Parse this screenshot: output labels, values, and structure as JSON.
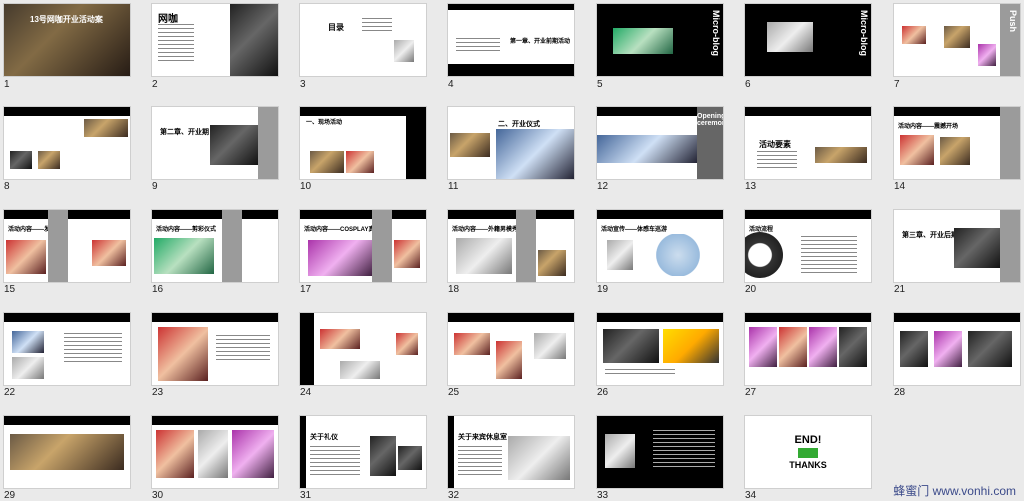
{
  "slides": [
    {
      "num": "1",
      "text": "13号网咖开业活动案"
    },
    {
      "num": "2",
      "text": "网咖"
    },
    {
      "num": "3",
      "text": "目录"
    },
    {
      "num": "4",
      "text": "第一章、开业前期活动"
    },
    {
      "num": "5",
      "text": "Micro-blog"
    },
    {
      "num": "6",
      "text": "Micro-blog"
    },
    {
      "num": "7",
      "text": "Push"
    },
    {
      "num": "8",
      "text": ""
    },
    {
      "num": "9",
      "text": "第二章、开业期"
    },
    {
      "num": "10",
      "text": "一、现场活动"
    },
    {
      "num": "11",
      "text": "二、开业仪式"
    },
    {
      "num": "12",
      "text": "Opening ceremony"
    },
    {
      "num": "13",
      "text": "活动要素"
    },
    {
      "num": "14",
      "text": "活动内容——震撼开场"
    },
    {
      "num": "15",
      "text": "活动内容——发扬传统"
    },
    {
      "num": "16",
      "text": "活动内容——剪彩仪式"
    },
    {
      "num": "17",
      "text": "活动内容——COSPLAY真人"
    },
    {
      "num": "18",
      "text": "活动内容——外籍男模秀"
    },
    {
      "num": "19",
      "text": "活动宣传——体感车巡游"
    },
    {
      "num": "20",
      "text": "活动流程"
    },
    {
      "num": "21",
      "text": "第三章、开业后期"
    },
    {
      "num": "22",
      "text": ""
    },
    {
      "num": "23",
      "text": ""
    },
    {
      "num": "24",
      "text": ""
    },
    {
      "num": "25",
      "text": ""
    },
    {
      "num": "26",
      "text": ""
    },
    {
      "num": "27",
      "text": ""
    },
    {
      "num": "28",
      "text": ""
    },
    {
      "num": "29",
      "text": ""
    },
    {
      "num": "30",
      "text": ""
    },
    {
      "num": "31",
      "text": "关于礼仪"
    },
    {
      "num": "32",
      "text": "关于来宾休息室"
    },
    {
      "num": "33",
      "text": ""
    },
    {
      "num": "34",
      "text": "END!"
    }
  ],
  "end_thanks": "THANKS",
  "watermark": "蜂蜜门 www.vonhi.com",
  "colors": {
    "bar": "#000000",
    "accent": "#9b9b9b",
    "background": "#eaeaea"
  }
}
